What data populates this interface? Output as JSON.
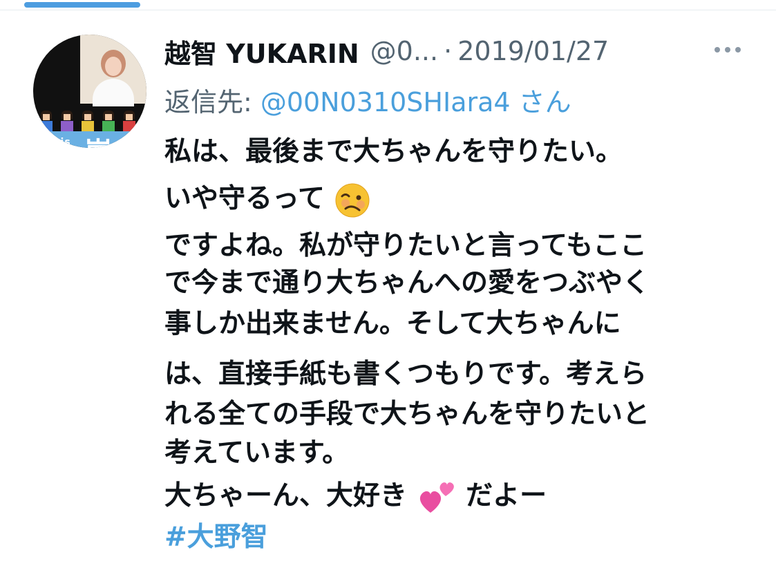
{
  "tweet": {
    "author": {
      "display_name": "越智 YUKARIN",
      "handle": "@0...",
      "avatar_badge": {
        "this_text": "This",
        "is_text": "is",
        "kanji": "嵐",
        "live_text": "LIVE"
      }
    },
    "separator": "·",
    "date": "2019/01/27",
    "more_icon": "more-horizontal-icon",
    "reply": {
      "prefix": "返信先:",
      "target": "@00N0310SHIara4 さん"
    },
    "body_lines": [
      "私は、最後まで大ちゃんを守りたい。",
      "いや守るって",
      "ですよね。私が守りたいと言ってもここ",
      "で今まで通り大ちゃんへの愛をつぶやく",
      "事しか出来ません。そして大ちゃんに",
      "は、直接手紙も書くつもりです。考えら",
      "れる全ての手段で大ちゃんを守りたいと",
      "考えています。",
      "大ちゃーん、大好き",
      "だよー"
    ],
    "emojis": {
      "woozy": "woozy-face-icon",
      "hearts": "two-hearts-icon"
    },
    "hashtag": "#大野智"
  },
  "colors": {
    "text": "#0f1419",
    "secondary": "#536471",
    "link": "#4a9fdc",
    "accent_bar": "#4d9de0"
  }
}
